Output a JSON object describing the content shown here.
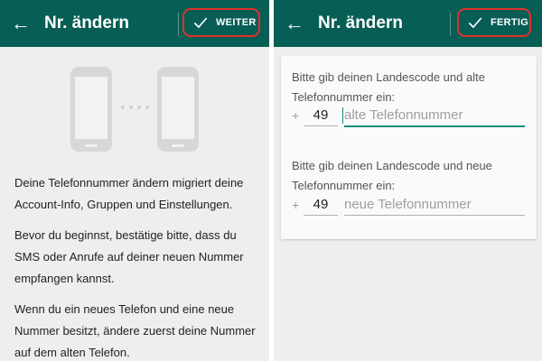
{
  "screens": {
    "left": {
      "title": "Nr. ändern",
      "back_icon": "back-arrow-icon",
      "action_label": "WEITER",
      "action_icon": "check-icon",
      "paragraphs": [
        "Deine Telefonnummer ändern migriert deine Account-Info, Gruppen und Einstellungen.",
        "Bevor du beginnst, bestätige bitte, dass du SMS oder Anrufe auf deiner neuen Nummer empfangen kannst.",
        "Wenn du ein neues Telefon und eine neue Nummer besitzt, ändere zuerst deine Nummer auf dem alten Telefon."
      ]
    },
    "right": {
      "title": "Nr. ändern",
      "back_icon": "back-arrow-icon",
      "action_label": "FERTIG",
      "action_icon": "check-icon",
      "old_number": {
        "prompt": "Bitte gib deinen Landescode und alte Telefonnummer ein:",
        "plus": "+",
        "country_code": "49",
        "placeholder": "alte Telefonnummer"
      },
      "new_number": {
        "prompt": "Bitte gib deinen Landescode und neue Telefonnummer ein:",
        "plus": "+",
        "country_code": "49",
        "placeholder": "neue Telefonnummer"
      }
    }
  },
  "colors": {
    "toolbar": "#075e54",
    "accent": "#128c7e",
    "highlight": "#e0312f",
    "background": "#eeeeee"
  }
}
